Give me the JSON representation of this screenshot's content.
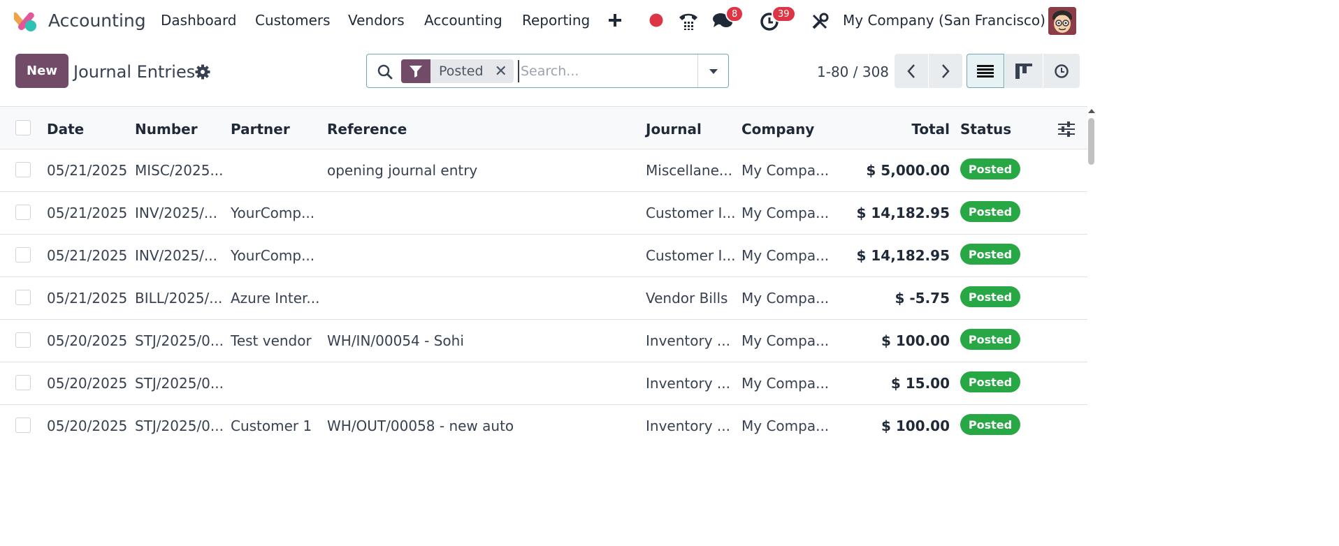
{
  "navbar": {
    "app_name": "Accounting",
    "menu": [
      "Dashboard",
      "Customers",
      "Vendors",
      "Accounting",
      "Reporting"
    ],
    "messages_count": "8",
    "activities_count": "39",
    "company": "My Company (San Francisco)"
  },
  "control": {
    "new_label": "New",
    "title": "Journal Entries",
    "facet_label": "Posted",
    "search_placeholder": "Search...",
    "pager": "1-80 / 308"
  },
  "table": {
    "headers": {
      "date": "Date",
      "number": "Number",
      "partner": "Partner",
      "reference": "Reference",
      "journal": "Journal",
      "company": "Company",
      "total": "Total",
      "status": "Status"
    },
    "rows": [
      {
        "date": "05/21/2025",
        "number": "MISC/2025...",
        "partner": "",
        "reference": "opening journal entry",
        "journal": "Miscellane...",
        "company": "My Compa...",
        "total": "$ 5,000.00",
        "status": "Posted"
      },
      {
        "date": "05/21/2025",
        "number": "INV/2025/...",
        "partner": "YourComp...",
        "reference": "",
        "journal": "Customer I...",
        "company": "My Compa...",
        "total": "$ 14,182.95",
        "status": "Posted"
      },
      {
        "date": "05/21/2025",
        "number": "INV/2025/...",
        "partner": "YourComp...",
        "reference": "",
        "journal": "Customer I...",
        "company": "My Compa...",
        "total": "$ 14,182.95",
        "status": "Posted"
      },
      {
        "date": "05/21/2025",
        "number": "BILL/2025/...",
        "partner": "Azure Inter...",
        "reference": "",
        "journal": "Vendor Bills",
        "company": "My Compa...",
        "total": "$ -5.75",
        "status": "Posted"
      },
      {
        "date": "05/20/2025",
        "number": "STJ/2025/0...",
        "partner": "Test vendor",
        "reference": "WH/IN/00054 - Sohi",
        "journal": "Inventory ...",
        "company": "My Compa...",
        "total": "$ 100.00",
        "status": "Posted"
      },
      {
        "date": "05/20/2025",
        "number": "STJ/2025/0...",
        "partner": "",
        "reference": "",
        "journal": "Inventory ...",
        "company": "My Compa...",
        "total": "$ 15.00",
        "status": "Posted"
      },
      {
        "date": "05/20/2025",
        "number": "STJ/2025/0...",
        "partner": "Customer 1",
        "reference": "WH/OUT/00058 - new auto",
        "journal": "Inventory ...",
        "company": "My Compa...",
        "total": "$ 100.00",
        "status": "Posted"
      }
    ]
  },
  "colors": {
    "brand": "#714b67",
    "status_posted": "#28a745",
    "badge": "#dc3545",
    "search_border": "#71a6b9"
  }
}
